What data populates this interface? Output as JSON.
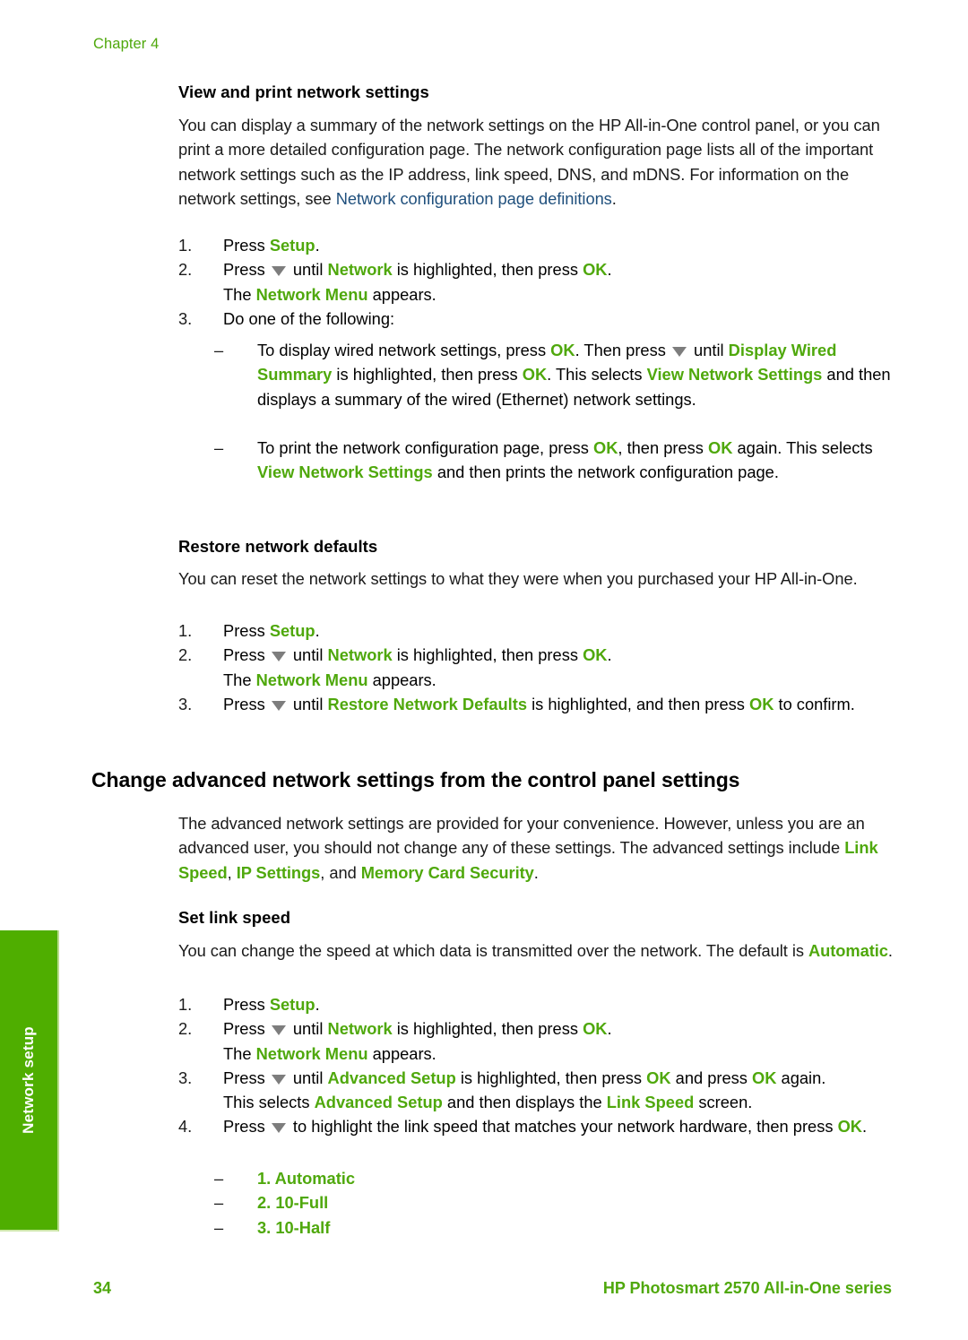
{
  "page": {
    "chapter_header": "Chapter 4",
    "side_tab_label": "Network setup",
    "footer_page_number": "34",
    "footer_product": "HP Photosmart 2570 All-in-One series",
    "colors": {
      "ui_green": "#4FA80C",
      "tab_green": "#4FAE00",
      "link_blue": "#20507D",
      "body_text": "#1a1a1a",
      "arrow_gray": "#7d7d7d"
    }
  },
  "section_view_print": {
    "heading": "View and print network settings",
    "intro": {
      "t1": "You can display a summary of the network settings on the HP All-in-One control panel, or you can print a more detailed configuration page. The network configuration page lists all of the important network settings such as the IP address, link speed, DNS, and mDNS. For information on the network settings, see ",
      "link": "Network configuration page definitions",
      "t2": "."
    },
    "steps": {
      "n1": "1.",
      "s1_a": "Press ",
      "s1_ui": "Setup",
      "s1_b": ".",
      "n2": "2.",
      "s2_a": "Press ",
      "s2_arrow": "down-arrow-icon",
      "s2_b": " until ",
      "s2_ui1": "Network",
      "s2_c": " is highlighted, then press ",
      "s2_ui2": "OK",
      "s2_d": ".",
      "s2_line2_a": "The ",
      "s2_line2_ui": "Network Menu",
      "s2_line2_b": " appears.",
      "n3": "3.",
      "s3": "Do one of the following:"
    },
    "bullets": [
      {
        "dash": "–",
        "p1_a": "To display wired network settings, press ",
        "p1_ui1": "OK",
        "p1_b": ". Then press ",
        "p1_arrow": "down-arrow-icon",
        "p1_c": " until ",
        "p1_ui2": "Display Wired Summary",
        "p1_d": " is highlighted, then press ",
        "p1_ui3": "OK",
        "p1_e": ".",
        "p2_a": "This selects ",
        "p2_ui": "View Network Settings",
        "p2_b": " and then displays a summary of the wired (Ethernet) network settings."
      },
      {
        "dash": "–",
        "p1_a": "To print the network configuration page, press ",
        "p1_ui1": "OK",
        "p1_b": ", then press ",
        "p1_ui2": "OK",
        "p1_c": " again.",
        "p2_a": "This selects ",
        "p2_ui": "View Network Settings",
        "p2_b": " and then prints the network configuration page."
      }
    ]
  },
  "section_restore": {
    "heading": "Restore network defaults",
    "intro": "You can reset the network settings to what they were when you purchased your HP All-in-One.",
    "steps": {
      "n1": "1.",
      "s1_a": "Press ",
      "s1_ui": "Setup",
      "s1_b": ".",
      "n2": "2.",
      "s2_a": "Press ",
      "s2_b": " until ",
      "s2_ui1": "Network",
      "s2_c": " is highlighted, then press ",
      "s2_ui2": "OK",
      "s2_d": ".",
      "s2_line2_a": "The ",
      "s2_line2_ui": "Network Menu",
      "s2_line2_b": " appears.",
      "n3": "3.",
      "s3_a": "Press ",
      "s3_b": " until ",
      "s3_ui1": "Restore Network Defaults",
      "s3_c": " is highlighted, and then press ",
      "s3_ui2": "OK",
      "s3_d": " to confirm."
    }
  },
  "section_change_advanced": {
    "heading": "Change advanced network settings from the control panel settings",
    "intro": {
      "t1": "The advanced network settings are provided for your convenience. However, unless you are an advanced user, you should not change any of these settings. The advanced settings include ",
      "ui1": "Link Speed",
      "t2": ", ",
      "ui2": "IP Settings",
      "t3": ", and ",
      "ui3": "Memory Card Security",
      "t4": "."
    }
  },
  "section_set_link_speed": {
    "heading": "Set link speed",
    "intro": {
      "t1": "You can change the speed at which data is transmitted over the network. The default is ",
      "ui1": "Automatic",
      "t2": "."
    },
    "steps": {
      "n1": "1.",
      "s1_a": "Press ",
      "s1_ui": "Setup",
      "s1_b": ".",
      "n2": "2.",
      "s2_a": "Press ",
      "s2_b": " until ",
      "s2_ui1": "Network",
      "s2_c": " is highlighted, then press ",
      "s2_ui2": "OK",
      "s2_d": ".",
      "s2_line2_a": "The ",
      "s2_line2_ui": "Network Menu",
      "s2_line2_b": " appears.",
      "n3": "3.",
      "s3_a": "Press ",
      "s3_b": " until ",
      "s3_ui1": "Advanced Setup",
      "s3_c": " is highlighted, then press ",
      "s3_ui2": "OK",
      "s3_d": " and press ",
      "s3_ui3": "OK",
      "s3_e": " again.",
      "s3_line2_a": "This selects ",
      "s3_line2_ui1": "Advanced Setup",
      "s3_line2_b": " and then displays the ",
      "s3_line2_ui2": "Link Speed",
      "s3_line2_c": " screen.",
      "n4": "4.",
      "s4_a": "Press ",
      "s4_b": " to highlight the link speed that matches your network hardware, then press ",
      "s4_ui": "OK",
      "s4_c": "."
    },
    "options": [
      {
        "dash": "–",
        "label": "1. Automatic"
      },
      {
        "dash": "–",
        "label": "2. 10-Full"
      },
      {
        "dash": "–",
        "label": "3. 10-Half"
      }
    ]
  }
}
